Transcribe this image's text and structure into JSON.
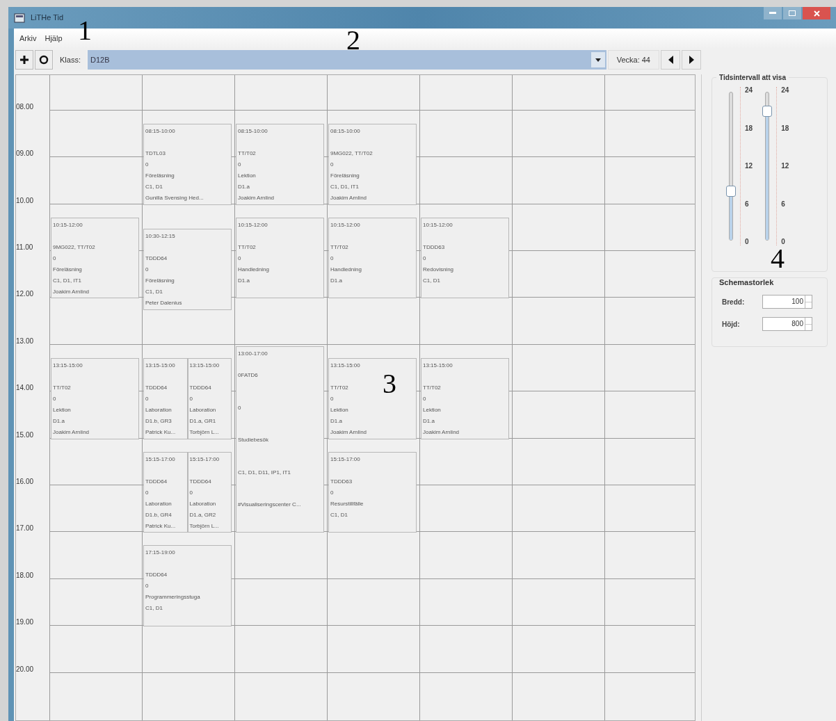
{
  "window": {
    "title": "LiTHe Tid"
  },
  "menu": [
    "Arkiv",
    "Hjälp"
  ],
  "toolbar": {
    "class_label": "Klass:",
    "class_value": "D12B",
    "week": "Vecka: 44"
  },
  "schedule": {
    "hours": [
      "08.00",
      "09.00",
      "10.00",
      "11.00",
      "12.00",
      "13.00",
      "14.00",
      "15.00",
      "16.00",
      "17.00",
      "18.00",
      "19.00",
      "20.00"
    ],
    "days": [
      {
        "events": [
          {
            "time": "10:15-12:00",
            "lines": [
              "9MG022, TT/T02",
              "0",
              "Föreläsning",
              "C1, D1, IT1",
              "Joakim Arnlind"
            ]
          },
          {
            "time": "13:15-15:00",
            "lines": [
              "TT/T02",
              "0",
              "Lektion",
              "D1.a",
              "Joakim Arnlind"
            ]
          }
        ]
      },
      {
        "events": [
          {
            "time": "08:15-10:00",
            "lines": [
              "TDTL03",
              "0",
              "Föreläsning",
              "C1, D1",
              "Gunilla Svensing Hed..."
            ]
          },
          {
            "time": "10:30-12:15",
            "lines": [
              "TDDD64",
              "0",
              "Föreläsning",
              "C1, D1",
              "Peter Dalenius"
            ]
          },
          {
            "time": "13:15-15:00",
            "lines": [
              "TDDD64",
              "0",
              "Laboration",
              "D1.b, GR3",
              "Patrick Ku..."
            ]
          },
          {
            "time": "13:15-15:00",
            "lines": [
              "TDDD64",
              "0",
              "Laboration",
              "D1.a, GR1",
              "Torbjörn L..."
            ]
          },
          {
            "time": "15:15-17:00",
            "lines": [
              "TDDD64",
              "0",
              "Laboration",
              "D1.b, GR4",
              "Patrick Ku..."
            ]
          },
          {
            "time": "15:15-17:00",
            "lines": [
              "TDDD64",
              "0",
              "Laboration",
              "D1.a, GR2",
              "Torbjörn L..."
            ]
          },
          {
            "time": "17:15-19:00",
            "lines": [
              "TDDD64",
              "0",
              "Programmeringsstuga",
              "C1, D1"
            ]
          }
        ]
      },
      {
        "events": [
          {
            "time": "08:15-10:00",
            "lines": [
              "TT/T02",
              "0",
              "Lektion",
              "D1.a",
              "Joakim Arnlind"
            ]
          },
          {
            "time": "10:15-12:00",
            "lines": [
              "TT/T02",
              "0",
              "Handledning",
              "D1.a"
            ]
          },
          {
            "time": "13:00-17:00",
            "lines": [
              "0FATD6",
              "0",
              "Studiebesök",
              "C1, D1, D11, IP1, IT1",
              "#Visualiseringscenter C..."
            ]
          }
        ]
      },
      {
        "events": [
          {
            "time": "08:15-10:00",
            "lines": [
              "9MG022, TT/T02",
              "0",
              "Föreläsning",
              "C1, D1, IT1",
              "Joakim Arnlind"
            ]
          },
          {
            "time": "10:15-12:00",
            "lines": [
              "TT/T02",
              "0",
              "Handledning",
              "D1.a"
            ]
          },
          {
            "time": "13:15-15:00",
            "lines": [
              "TT/T02",
              "0",
              "Lektion",
              "D1.a",
              "Joakim Arnlind"
            ]
          },
          {
            "time": "15:15-17:00",
            "lines": [
              "TDDD63",
              "0",
              "Resurstillfälle",
              "C1, D1"
            ]
          }
        ]
      },
      {
        "events": [
          {
            "time": "10:15-12:00",
            "lines": [
              "TDDD63",
              "0",
              "Redovisning",
              "C1, D1"
            ]
          },
          {
            "time": "13:15-15:00",
            "lines": [
              "TT/T02",
              "0",
              "Lektion",
              "D1.a",
              "Joakim Arnlind"
            ]
          }
        ]
      }
    ]
  },
  "time_range": {
    "title": "Tidsintervall att visa",
    "sliders": [
      {
        "level": 0.33,
        "scale": [
          "24",
          "18",
          "12",
          "6",
          "0"
        ]
      },
      {
        "level": 0.875,
        "scale": [
          "24",
          "18",
          "12",
          "6",
          "0"
        ]
      }
    ]
  },
  "size": {
    "title": "Schemastorlek",
    "fields": [
      {
        "label": "Bredd:",
        "value": "100"
      },
      {
        "label": "Höjd:",
        "value": "800"
      }
    ]
  },
  "annotations": [
    "1",
    "2",
    "3",
    "4"
  ]
}
